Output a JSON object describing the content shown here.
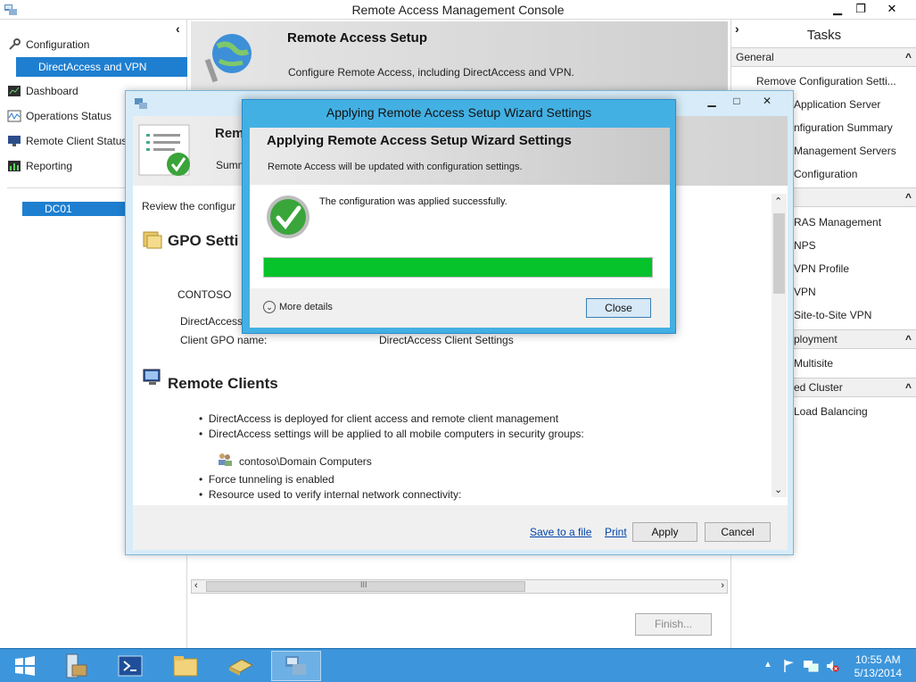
{
  "window": {
    "title": "Remote Access Management Console"
  },
  "nav": {
    "items": [
      {
        "label": "Configuration"
      },
      {
        "label": "DirectAccess and VPN"
      },
      {
        "label": "Dashboard"
      },
      {
        "label": "Operations Status"
      },
      {
        "label": "Remote Client Status"
      },
      {
        "label": "Reporting"
      }
    ],
    "server": "DC01"
  },
  "center": {
    "title": "Remote Access Setup",
    "subtitle": "Configure Remote Access, including DirectAccess and VPN.",
    "finish_label": "Finish...",
    "scroll_grip": "III"
  },
  "tasks": {
    "title": "Tasks",
    "sections": [
      {
        "label": "General",
        "items": [
          "Remove Configuration Setti...",
          "Application Server",
          "nfiguration Summary",
          "Management Servers",
          "Configuration"
        ]
      },
      {
        "label": "",
        "items": [
          "RAS Management",
          "NPS",
          "VPN Profile",
          "VPN",
          "Site-to-Site VPN"
        ]
      },
      {
        "label": "ployment",
        "items": [
          "Multisite"
        ]
      },
      {
        "label": "ed Cluster",
        "items": [
          "Load Balancing"
        ]
      }
    ]
  },
  "review": {
    "head_title": "Rem",
    "head_sub": "Summ",
    "intro": "Review the configur",
    "gpo_heading": "GPO Setti",
    "domain": "CONTOSO",
    "rows": [
      {
        "label": "DirectAccess",
        "value": ""
      },
      {
        "label": "Client GPO name:",
        "value": "DirectAccess Client Settings"
      }
    ],
    "clients_heading": "Remote Clients",
    "bullets": [
      "DirectAccess is deployed for client access and remote client management",
      "DirectAccess settings will be applied to all mobile computers in security groups:"
    ],
    "group": "contoso\\Domain Computers",
    "bullets2": [
      "Force tunneling is enabled",
      "Resource used to verify internal network connectivity:"
    ],
    "save_link": "Save to a file",
    "print_link": "Print",
    "apply_label": "Apply",
    "cancel_label": "Cancel"
  },
  "apply_dialog": {
    "window_title": "Applying Remote Access Setup Wizard Settings",
    "heading": "Applying Remote Access Setup Wizard Settings",
    "subheading": "Remote Access will be updated with configuration settings.",
    "message": "The configuration was applied successfully.",
    "progress": 1.0,
    "more_details": "More details",
    "close_label": "Close"
  },
  "taskbar": {
    "time": "10:55 AM",
    "date": "5/13/2014"
  },
  "colors": {
    "accent": "#1e7fd0",
    "dialog_frame": "#43b0e3",
    "progress": "#06c22b",
    "taskbar": "#3d96dc"
  }
}
